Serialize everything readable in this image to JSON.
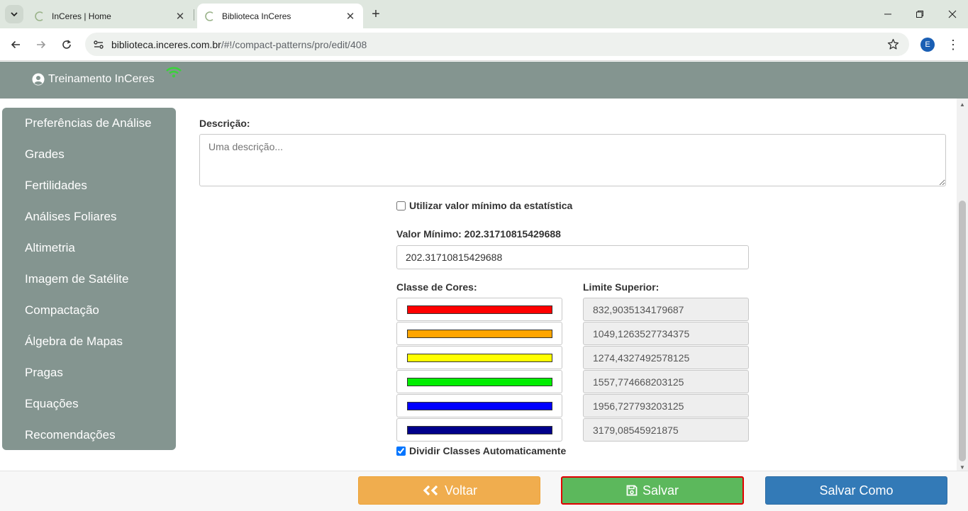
{
  "browser": {
    "tabs": [
      {
        "title": "InCeres | Home",
        "active": false
      },
      {
        "title": "Biblioteca InCeres",
        "active": true
      }
    ],
    "url_host": "biblioteca.inceres.com.br",
    "url_path": "/#!/compact-patterns/pro/edit/408",
    "profile_initial": "E"
  },
  "header": {
    "user_name": "Treinamento InCeres"
  },
  "sidebar": {
    "items": [
      {
        "label": "Preferências de Análise"
      },
      {
        "label": "Grades"
      },
      {
        "label": "Fertilidades"
      },
      {
        "label": "Análises Foliares"
      },
      {
        "label": "Altimetria"
      },
      {
        "label": "Imagem de Satélite"
      },
      {
        "label": "Compactação"
      },
      {
        "label": "Álgebra de Mapas"
      },
      {
        "label": "Pragas"
      },
      {
        "label": "Equações"
      },
      {
        "label": "Recomendações"
      }
    ]
  },
  "form": {
    "description_label": "Descrição:",
    "description_placeholder": "Uma descrição...",
    "use_min_stat_label": "Utilizar valor mínimo da estatística",
    "use_min_stat_checked": false,
    "min_value_label": "Valor Mínimo: 202.31710815429688",
    "min_value": "202.31710815429688",
    "color_class_header": "Classe de Cores:",
    "upper_limit_header": "Limite Superior:",
    "classes": [
      {
        "color": "#ff0000",
        "limit": "832,9035134179687"
      },
      {
        "color": "#ffa500",
        "limit": "1049,1263527734375"
      },
      {
        "color": "#ffff00",
        "limit": "1274,4327492578125"
      },
      {
        "color": "#00ee00",
        "limit": "1557,774668203125"
      },
      {
        "color": "#0000ff",
        "limit": "1956,727793203125"
      },
      {
        "color": "#00008b",
        "limit": "3179,08545921875"
      }
    ],
    "auto_divide_label": "Dividir Classes Automaticamente",
    "auto_divide_checked": true
  },
  "footer": {
    "back_label": "Voltar",
    "save_label": "Salvar",
    "save_as_label": "Salvar Como"
  }
}
